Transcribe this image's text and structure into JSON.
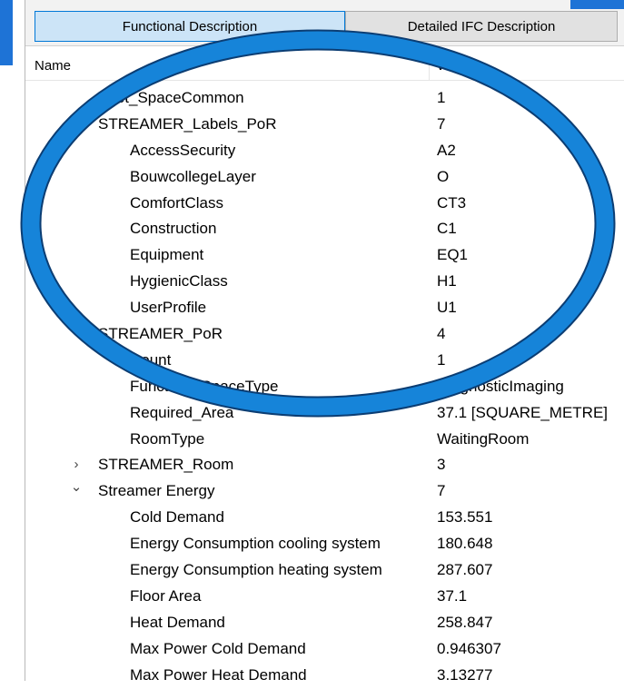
{
  "tabs": {
    "functional": "Functional Description",
    "detailed": "Detailed IFC Description"
  },
  "columns": {
    "name": "Name",
    "value": "Value"
  },
  "rows": [
    {
      "name": "Pset_SpaceCommon",
      "value": "1",
      "level": 0,
      "expander": "none"
    },
    {
      "name": "STREAMER_Labels_PoR",
      "value": "7",
      "level": 0,
      "expander": "expanded"
    },
    {
      "name": "AccessSecurity",
      "value": "A2",
      "level": 1
    },
    {
      "name": "BouwcollegeLayer",
      "value": "O",
      "level": 1
    },
    {
      "name": "ComfortClass",
      "value": "CT3",
      "level": 1
    },
    {
      "name": "Construction",
      "value": "C1",
      "level": 1
    },
    {
      "name": "Equipment",
      "value": "EQ1",
      "level": 1
    },
    {
      "name": "HygienicClass",
      "value": "H1",
      "level": 1
    },
    {
      "name": "UserProfile",
      "value": "U1",
      "level": 1
    },
    {
      "name": "STREAMER_PoR",
      "value": "4",
      "level": 0,
      "expander": "expanded"
    },
    {
      "name": "Count",
      "value": "1",
      "level": 1
    },
    {
      "name": "FunctionalSpaceType",
      "value": "DiagnosticImaging",
      "level": 1
    },
    {
      "name": "Required_Area",
      "value": "37.1 [SQUARE_METRE]",
      "level": 1
    },
    {
      "name": "RoomType",
      "value": "WaitingRoom",
      "level": 1
    },
    {
      "name": "STREAMER_Room",
      "value": "3",
      "level": 0,
      "expander": "collapsed"
    },
    {
      "name": "Streamer Energy",
      "value": "7",
      "level": 0,
      "expander": "expanded"
    },
    {
      "name": "Cold Demand",
      "value": "153.551",
      "level": 1
    },
    {
      "name": "Energy Consumption cooling system",
      "value": "180.648",
      "level": 1
    },
    {
      "name": "Energy Consumption heating system",
      "value": "287.607",
      "level": 1
    },
    {
      "name": "Floor Area",
      "value": "37.1",
      "level": 1
    },
    {
      "name": "Heat Demand",
      "value": "258.847",
      "level": 1
    },
    {
      "name": "Max Power Cold Demand",
      "value": "0.946307",
      "level": 1
    },
    {
      "name": "Max Power Heat Demand",
      "value": "3.13277",
      "level": 1
    }
  ],
  "colors": {
    "accent": "#1e73d6",
    "highlight_ring": "#1684d9",
    "ring_outline": "#0b3d73"
  },
  "icons": {
    "expanded": "chevron-down-icon",
    "collapsed": "chevron-right-icon"
  }
}
